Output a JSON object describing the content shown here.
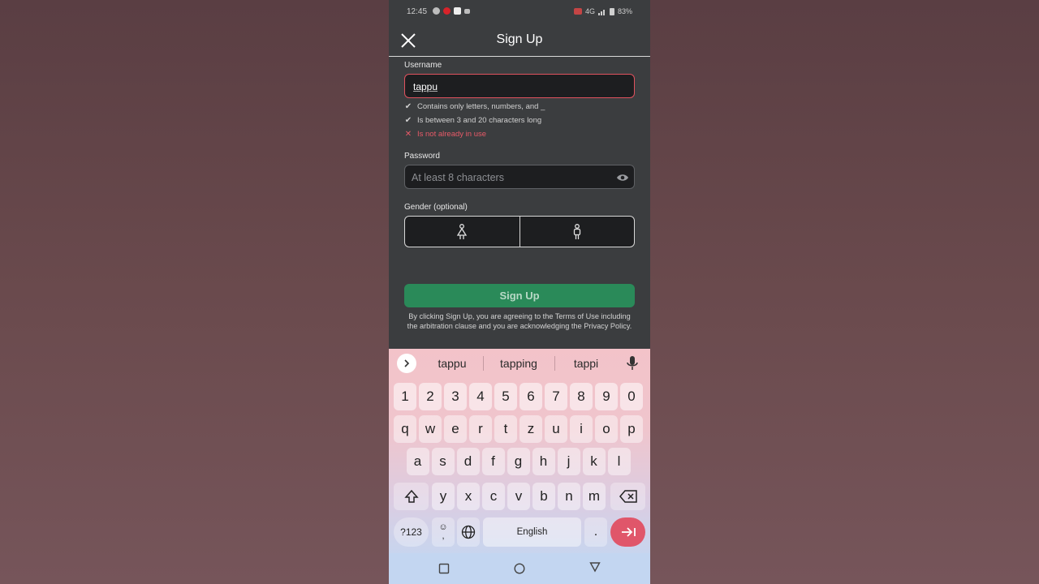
{
  "status_bar": {
    "time": "12:45",
    "network": "4G",
    "battery": "83%"
  },
  "header": {
    "title": "Sign Up",
    "close_icon": "close-icon"
  },
  "form": {
    "username": {
      "label": "Username",
      "value": "tappu"
    },
    "rules": [
      {
        "text": "Contains only letters, numbers, and _",
        "status": "ok",
        "icon": "✔"
      },
      {
        "text": "Is between 3 and 20 characters long",
        "status": "ok",
        "icon": "✔"
      },
      {
        "text": "Is not already in use",
        "status": "bad",
        "icon": "✕"
      }
    ],
    "password": {
      "label": "Password",
      "placeholder": "At least 8 characters"
    },
    "gender": {
      "label": "Gender (optional)",
      "options": [
        "female-icon",
        "male-icon"
      ]
    },
    "submit_label": "Sign Up",
    "legal_text": "By clicking Sign Up, you are agreeing to the Terms of Use including the arbitration clause and you are acknowledging the Privacy Policy."
  },
  "keyboard": {
    "suggestions": [
      "tappu",
      "tapping",
      "tappi"
    ],
    "row_numbers": [
      "1",
      "2",
      "3",
      "4",
      "5",
      "6",
      "7",
      "8",
      "9",
      "0"
    ],
    "row1": [
      "q",
      "w",
      "e",
      "r",
      "t",
      "z",
      "u",
      "i",
      "o",
      "p"
    ],
    "row2": [
      "a",
      "s",
      "d",
      "f",
      "g",
      "h",
      "j",
      "k",
      "l"
    ],
    "row3": [
      "y",
      "x",
      "c",
      "v",
      "b",
      "n",
      "m"
    ],
    "symbols_label": "?123",
    "emoji_label": "☺",
    "comma_label": ",",
    "space_label": "English",
    "period_label": ".",
    "accent_color": "#e0566a"
  },
  "colors": {
    "primary_button": "#2a8a59",
    "error": "#e85a68",
    "background": "#3b3d3f"
  }
}
